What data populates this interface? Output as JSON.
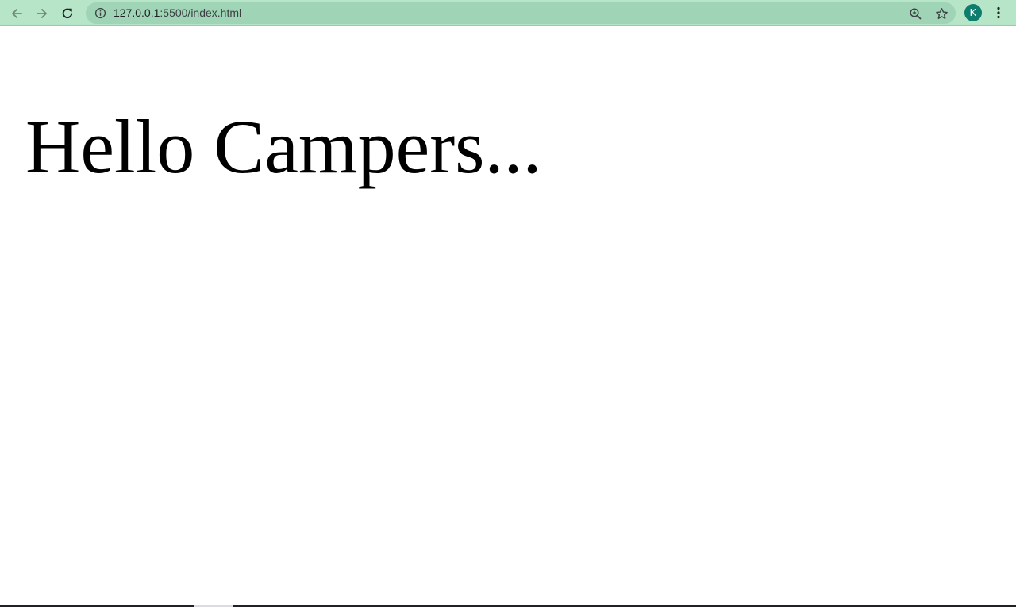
{
  "browser": {
    "url_host": "127.0.0.1",
    "url_path": ":5500/index.html",
    "profile_initial": "K",
    "icons": {
      "back": "arrow-left-icon",
      "forward": "arrow-right-icon",
      "reload": "reload-icon",
      "site_info": "info-icon",
      "zoom": "zoom-in-icon",
      "bookmark": "star-icon",
      "menu": "kebab-menu-icon"
    },
    "colors": {
      "toolbar": "#b7e5c8",
      "omnibox": "#a0d4b6",
      "avatar": "#0f7d6e"
    }
  },
  "page": {
    "heading": "Hello Campers..."
  }
}
